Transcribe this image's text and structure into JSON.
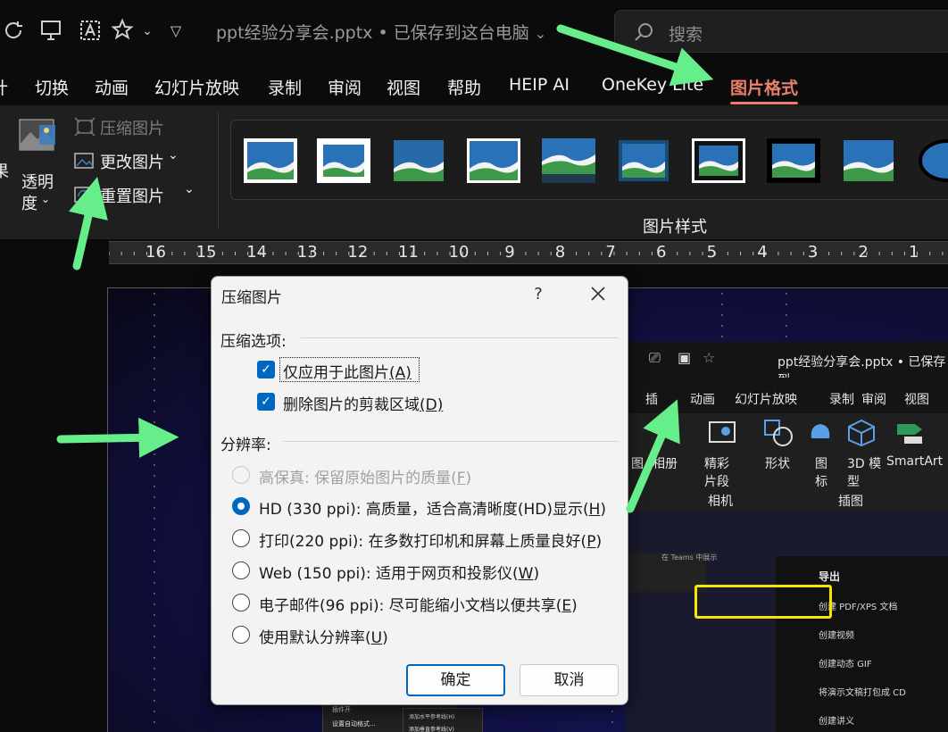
{
  "titlebar": {
    "doc_title": "ppt经验分享会.pptx • 已保存到这台电脑",
    "search_placeholder": "搜索"
  },
  "tabs": [
    {
      "label": "计"
    },
    {
      "label": "切换"
    },
    {
      "label": "动画"
    },
    {
      "label": "幻灯片放映"
    },
    {
      "label": "录制"
    },
    {
      "label": "审阅"
    },
    {
      "label": "视图"
    },
    {
      "label": "帮助"
    },
    {
      "label": "HEIP AI"
    },
    {
      "label": "OneKey Lite"
    },
    {
      "label": "图片格式"
    }
  ],
  "ribbon": {
    "partial_left": "果",
    "transparency_label_1": "透明",
    "transparency_label_2": "度",
    "compress_label": "压缩图片",
    "change_label": "更改图片",
    "reset_label": "重置图片",
    "styles_group_label": "图片样式"
  },
  "ruler": {
    "numbers": [
      "16",
      "15",
      "14",
      "13",
      "12",
      "11",
      "10",
      "9",
      "8",
      "7",
      "6",
      "5",
      "4",
      "3",
      "2",
      "1"
    ]
  },
  "nested": {
    "doc_title": "ppt经验分享会.pptx • 已保存到",
    "tabs": [
      "插",
      "动画",
      "幻灯片放映",
      "录制",
      "审阅",
      "视图"
    ],
    "ribbon_items": [
      "图",
      "相册",
      "精彩片段",
      "形状",
      "图标",
      "3D 模型",
      "SmartArt"
    ],
    "group_labels": [
      "相机",
      "插图"
    ],
    "teams_label": "在 Teams 中展示",
    "export_title": "导出",
    "export_items": [
      "创建 PDF/XPS 文档",
      "创建视频",
      "创建动态 GIF",
      "将演示文稿打包成 CD",
      "创建讲义"
    ],
    "small_menu": [
      "插件开",
      "设置自动格式..."
    ],
    "small_menu2": [
      "添加水平参考线(H)",
      "添加垂直参考线(V)"
    ]
  },
  "dialog": {
    "title": "压缩图片",
    "help": "?",
    "compress_section": "压缩选项:",
    "cb_apply_only": "仅应用于此图片",
    "cb_apply_only_key": "(A)",
    "cb_delete_crop": "删除图片的剪裁区域",
    "cb_delete_crop_key": "(D)",
    "resolution_section": "分辨率:",
    "radios": [
      {
        "label": "高保真: 保留原始图片的质量(",
        "key": "F",
        "end": ")",
        "checked": false,
        "disabled": true
      },
      {
        "label": "HD (330 ppi): 高质量，适合高清晰度(HD)显示(",
        "key": "H",
        "end": ")",
        "checked": true,
        "disabled": false
      },
      {
        "label": "打印(220 ppi): 在多数打印机和屏幕上质量良好(",
        "key": "P",
        "end": ")",
        "checked": false,
        "disabled": false
      },
      {
        "label": "Web (150 ppi): 适用于网页和投影仪(",
        "key": "W",
        "end": ")",
        "checked": false,
        "disabled": false
      },
      {
        "label": "电子邮件(96 ppi): 尽可能缩小文档以便共享(",
        "key": "E",
        "end": ")",
        "checked": false,
        "disabled": false
      },
      {
        "label": "使用默认分辨率(",
        "key": "U",
        "end": ")",
        "checked": false,
        "disabled": false
      }
    ],
    "ok_label": "确定",
    "cancel_label": "取消"
  },
  "colors": {
    "accent_tab": "#e8806a",
    "dialog_accent": "#0067c0",
    "annotation_arrow": "#66ee8a",
    "highlight_box": "#f7e400"
  }
}
